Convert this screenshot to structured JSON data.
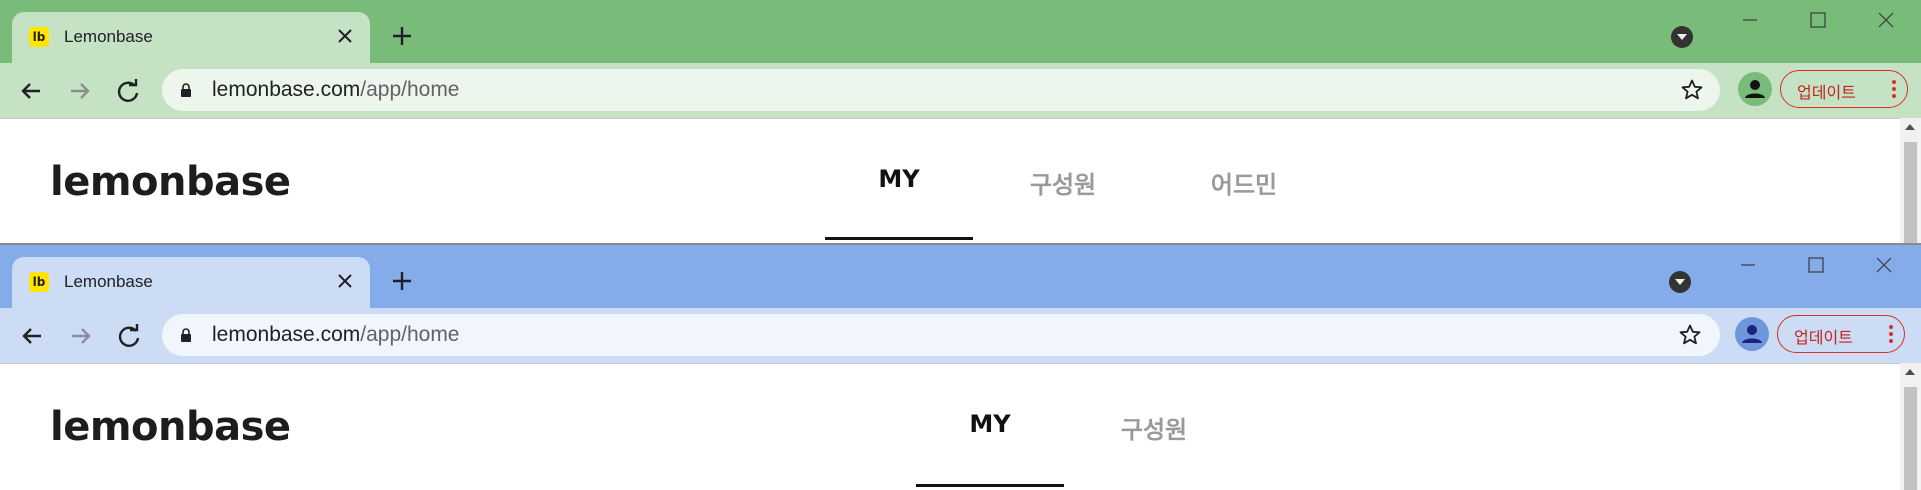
{
  "windows": [
    {
      "theme": {
        "frame": "#79bb79",
        "tab": "#c5e2c5",
        "toolbar": "#c5e2c5",
        "omnibox": "#edf6ed",
        "profile_bg": "#79bb79"
      },
      "tab_title": "Lemonbase",
      "favicon": "lb",
      "url_domain": "lemonbase.com",
      "url_path": "/app/home",
      "update_label": "업데이트",
      "logo": "lemonbase",
      "nav_tabs": [
        {
          "label": "MY",
          "active": true
        },
        {
          "label": "구성원",
          "active": false
        },
        {
          "label": "어드민",
          "active": false
        }
      ]
    },
    {
      "theme": {
        "frame": "#85acea",
        "tab": "#cddcf5",
        "toolbar": "#cddcf5",
        "omnibox": "#f1f5fc",
        "profile_bg": "#6f96db"
      },
      "tab_title": "Lemonbase",
      "favicon": "lb",
      "url_domain": "lemonbase.com",
      "url_path": "/app/home",
      "update_label": "업데이트",
      "logo": "lemonbase",
      "nav_tabs": [
        {
          "label": "MY",
          "active": true
        },
        {
          "label": "구성원",
          "active": false
        }
      ]
    }
  ]
}
